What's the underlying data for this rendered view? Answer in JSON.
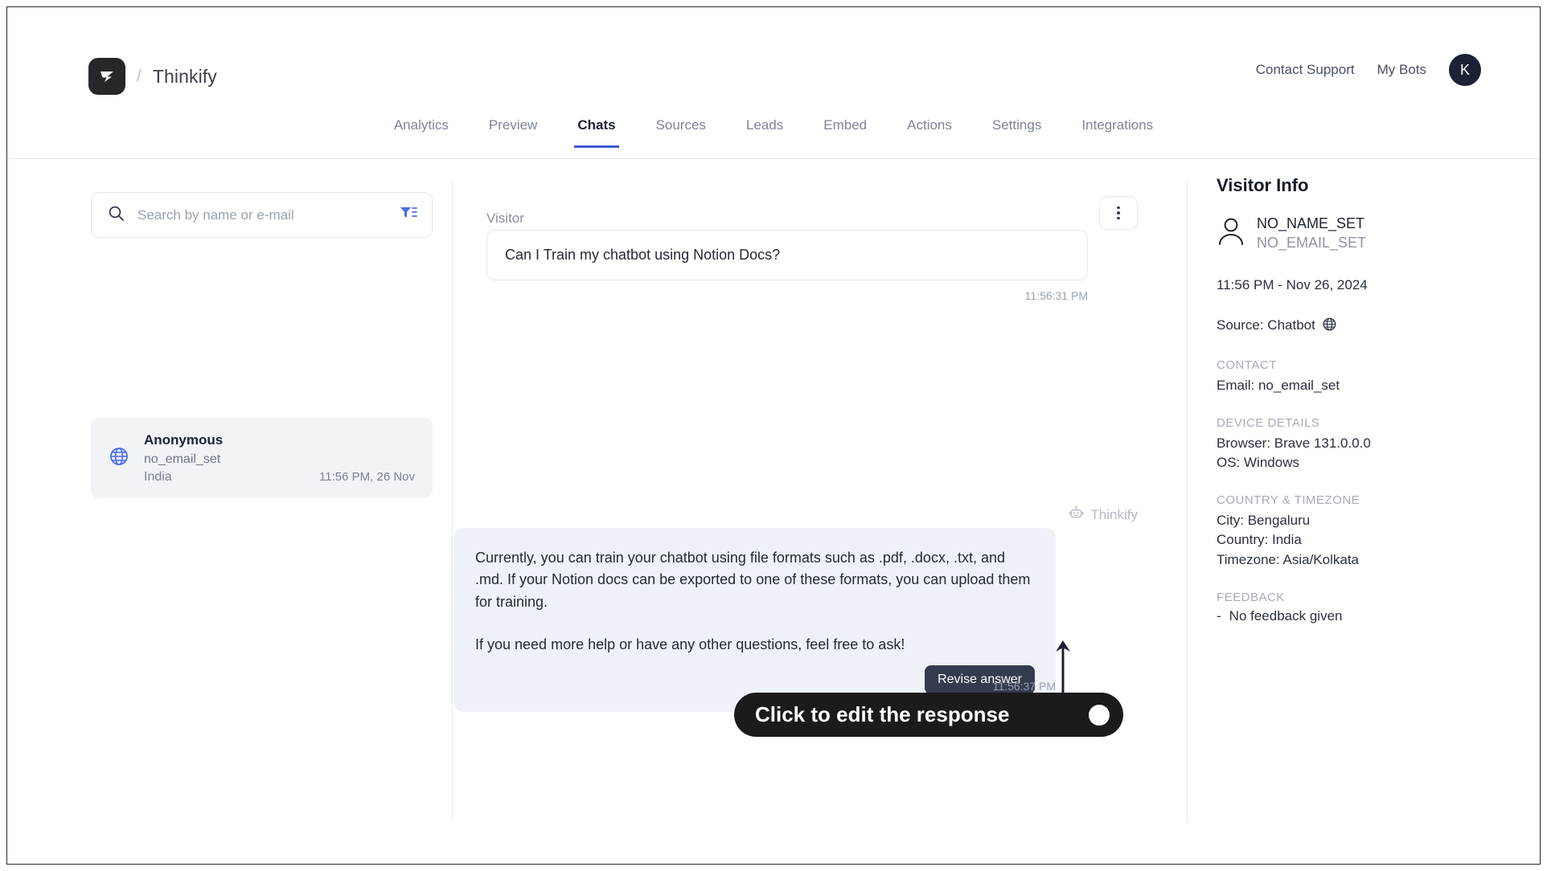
{
  "header": {
    "brand_name": "Thinkify",
    "separator": "/",
    "logo_icon": "thinkify-logo-icon",
    "links": [
      {
        "label": "Contact Support",
        "name": "contact-support-link"
      },
      {
        "label": "My Bots",
        "name": "my-bots-link"
      }
    ],
    "avatar_initial": "K"
  },
  "tabs": [
    {
      "label": "Analytics",
      "active": false
    },
    {
      "label": "Preview",
      "active": false
    },
    {
      "label": "Chats",
      "active": true
    },
    {
      "label": "Sources",
      "active": false
    },
    {
      "label": "Leads",
      "active": false
    },
    {
      "label": "Embed",
      "active": false
    },
    {
      "label": "Actions",
      "active": false
    },
    {
      "label": "Settings",
      "active": false
    },
    {
      "label": "Integrations",
      "active": false
    }
  ],
  "conversation_list": {
    "search": {
      "placeholder": "Search by name or e-mail",
      "value": "",
      "search_icon": "search-icon",
      "filter_icon": "filter-icon"
    },
    "items": [
      {
        "name": "Anonymous",
        "email": "no_email_set",
        "country": "India",
        "time": "11:56 PM, 26 Nov",
        "channel_icon": "globe-icon",
        "selected": true
      }
    ]
  },
  "chat": {
    "menu_icon": "kebab-menu-icon",
    "visitor_label": "Visitor",
    "visitor_message": "Can I Train my chatbot using Notion Docs?",
    "visitor_timestamp": "11:56:31 PM",
    "bot_label": "Thinkify",
    "bot_icon": "robot-icon",
    "bot_paragraph_1": "Currently, you can train your chatbot using file formats such as .pdf, .docx, .txt, and .md. If your Notion docs can be exported to one of these formats, you can upload them for training.",
    "bot_paragraph_2": "If you need more help or have any other questions, feel free to ask!",
    "revise_label": "Revise answer",
    "bot_timestamp": "11:56:37 PM"
  },
  "callout": {
    "text": "Click to edit the response"
  },
  "visitor_info": {
    "title": "Visitor Info",
    "person_icon": "person-icon",
    "name": "NO_NAME_SET",
    "email_display": "NO_EMAIL_SET",
    "datetime": "11:56 PM - Nov 26, 2024",
    "source": "Source: Chatbot",
    "source_icon": "globe-icon",
    "contact": {
      "title": "CONTACT",
      "email": "Email: no_email_set"
    },
    "device": {
      "title": "DEVICE DETAILS",
      "browser": "Browser: Brave 131.0.0.0",
      "os": "OS: Windows"
    },
    "location": {
      "title": "COUNTRY & TIMEZONE",
      "city": "City: Bengaluru",
      "country": "Country: India",
      "timezone": "Timezone: Asia/Kolkata"
    },
    "feedback": {
      "title": "FEEDBACK",
      "bullet": "-",
      "value": "No feedback given"
    }
  },
  "colors": {
    "accent": "#3a5bd9",
    "logo_bg": "#26262b",
    "bot_bubble": "#eef2f8",
    "revise_btn": "#343b4f",
    "callout_bg": "#1c1b1b",
    "filter_icon": "#4a6cf0"
  }
}
